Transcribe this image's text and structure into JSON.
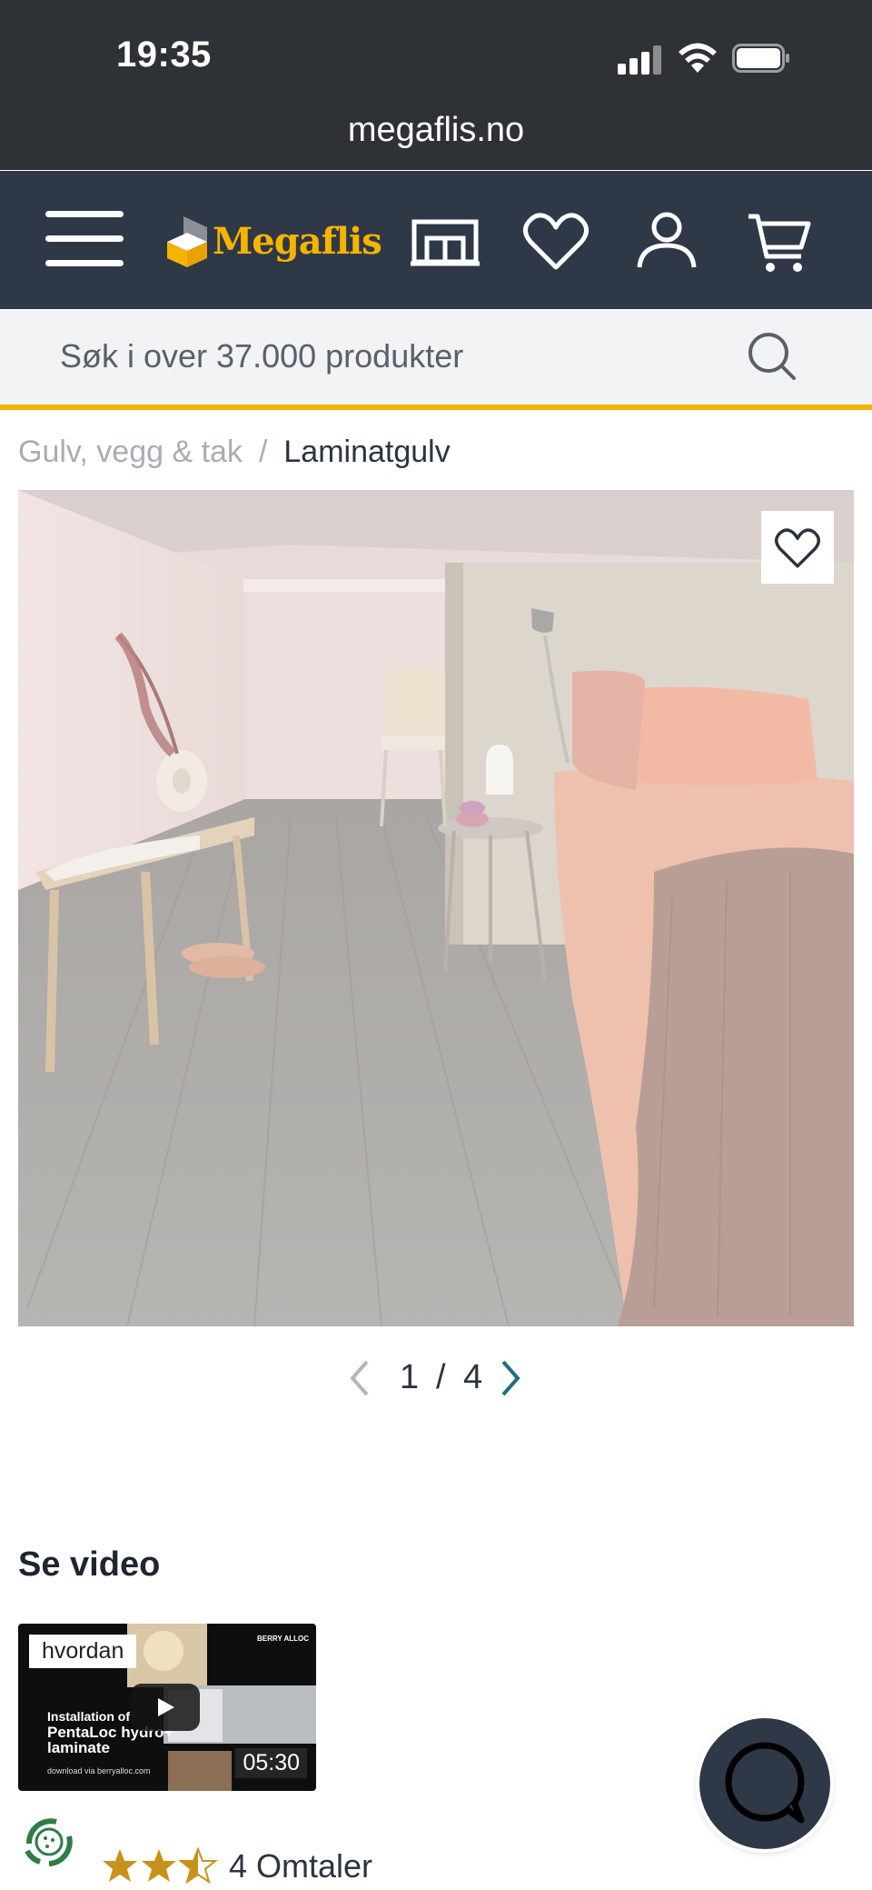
{
  "status_bar": {
    "time": "19:35"
  },
  "browser": {
    "url": "megaflis.no"
  },
  "header": {
    "logo_text": "Megaflis",
    "colors": {
      "background": "#2f3847",
      "brand": "#f4b400"
    },
    "icons": [
      "menu-icon",
      "store-icon",
      "heart-icon",
      "user-icon",
      "cart-icon"
    ]
  },
  "search": {
    "placeholder": "Søk i over 37.000 produkter"
  },
  "breadcrumb": {
    "parent": "Gulv, vegg & tak",
    "separator": "/",
    "current": "Laminatgulv"
  },
  "gallery": {
    "current": "1",
    "separator": "/",
    "total": "4",
    "current_index": 1,
    "total_count": 4
  },
  "video_section": {
    "title": "Se video",
    "thumbnail": {
      "tag": "hvordan",
      "line1": "Installation of",
      "line2": "PentaLoc hydro+",
      "line3": "laminate",
      "small": "download via berryalloc.com",
      "brand": "BERRY ALLOC",
      "duration": "05:30"
    }
  },
  "rating": {
    "stars": 2.5,
    "max": 3,
    "reviews_label": "4 Omtaler"
  }
}
